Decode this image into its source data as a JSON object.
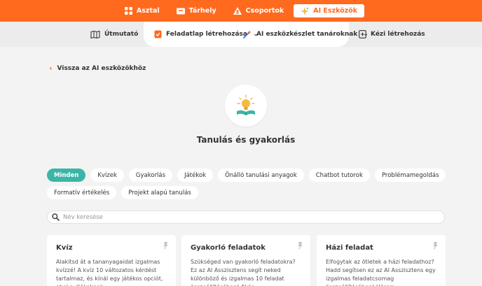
{
  "topnav": {
    "items": [
      {
        "label": "Asztal",
        "icon": "grid-icon"
      },
      {
        "label": "Tárhely",
        "icon": "folder-icon"
      },
      {
        "label": "Csoportok",
        "icon": "group-icon"
      },
      {
        "label": "AI Eszközök",
        "icon": "sparkle-icon"
      }
    ],
    "active_index": 3
  },
  "subnav": {
    "guide": "Útmutató",
    "worksheet": "Feladatlap létrehozása",
    "ai_toolkit": "AI eszközkészlet tanároknak",
    "manual": "Kézi létrehozás"
  },
  "back_link": "Vissza az AI eszközökhöz",
  "page_title": "Tanulás és gyakorlás",
  "filters": {
    "row1": [
      "Minden",
      "Kvízek",
      "Gyakorlás",
      "Játékok",
      "Önálló tanulási anyagok",
      "Chatbot tutorok",
      "Problémamegoldás"
    ],
    "row2": [
      "Formatív értékelés",
      "Projekt alapú tanulás"
    ],
    "active": "Minden"
  },
  "search": {
    "placeholder": "Név keresése",
    "value": ""
  },
  "cards": [
    {
      "title": "Kvíz",
      "desc": "Alakítsd át a tananyagaidat izgalmas kvízzé! A kvíz 10 változatos kérdést tartalmaz, és kínál egy játékos opciót, ahol a diákoknak..."
    },
    {
      "title": "Gyakorló feladatok",
      "desc": "Szükséged van gyakorló feladatokra? Ez az AI Asszisztens segít neked különböző és izgalmas 10 feladat összeállításában! Akár..."
    },
    {
      "title": "Házi feladat",
      "desc": "Elfogytak az ötletek a házi feladathoz? Hadd segítsen ez az AI Asszisztens egy izgalmas feladatcsomag összeállításában! Három..."
    }
  ],
  "colors": {
    "brand": "#ff6a1f",
    "accent": "#3bb6a6"
  }
}
